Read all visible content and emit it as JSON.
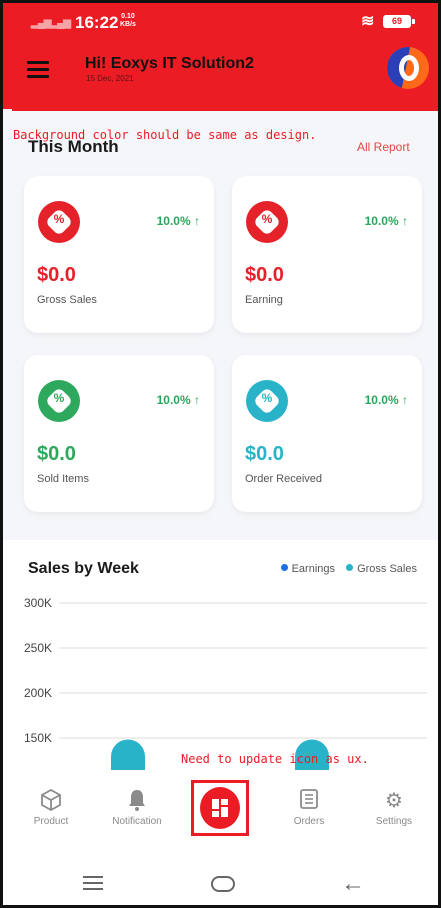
{
  "status_bar": {
    "time": "16:22",
    "speed_value": "0.10",
    "speed_unit": "KB/s",
    "battery": "69"
  },
  "header": {
    "greeting": "Hi! Eoxys IT Solution2",
    "date": "15 Dec, 2021",
    "background_color": "#ec1c24"
  },
  "annotations": {
    "header_note": "Background color should be same as design.",
    "icon_note": "Need to update icon as ux."
  },
  "this_month": {
    "title": "This Month",
    "all_report_label": "All Report"
  },
  "stats": [
    {
      "icon": "percent-badge-icon",
      "color": "#e5222a",
      "change": "10.0%",
      "value": "$0.0",
      "label": "Gross Sales"
    },
    {
      "icon": "percent-badge-icon",
      "color": "#e5222a",
      "change": "10.0%",
      "value": "$0.0",
      "label": "Earning"
    },
    {
      "icon": "percent-badge-icon",
      "color": "#2ea85c",
      "change": "10.0%",
      "value": "$0.0",
      "label": "Sold Items"
    },
    {
      "icon": "percent-badge-icon",
      "color": "#28b3c9",
      "change": "10.0%",
      "value": "$0.0",
      "label": "Order Received"
    }
  ],
  "chart_data": {
    "type": "bar",
    "title": "Sales by Week",
    "y_ticks": [
      "300K",
      "250K",
      "200K",
      "150K"
    ],
    "ylim": [
      150000,
      300000
    ],
    "legend": [
      {
        "name": "Earnings",
        "color": "#1e6fe0"
      },
      {
        "name": "Gross Sales",
        "color": "#28b3c9"
      }
    ],
    "legend_position": "top-right",
    "series": [
      {
        "name": "Gross Sales",
        "values": [
          145000,
          145000
        ]
      }
    ]
  },
  "bottom_nav": {
    "items": [
      {
        "label": "Product",
        "icon": "cube-icon"
      },
      {
        "label": "Notification",
        "icon": "bell-icon"
      },
      {
        "label": "",
        "icon": "dashboard-icon"
      },
      {
        "label": "Orders",
        "icon": "list-icon"
      },
      {
        "label": "Settings",
        "icon": "gear-icon"
      }
    ]
  }
}
